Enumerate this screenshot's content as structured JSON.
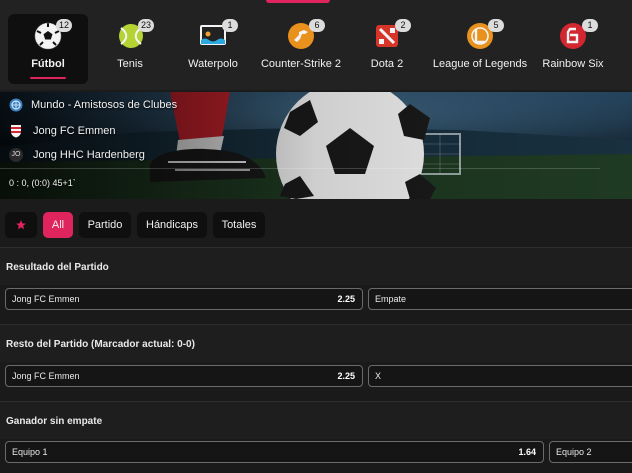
{
  "sports": [
    {
      "label": "Fútbol",
      "count": "12",
      "icon": "soccer-ball-icon",
      "active": true
    },
    {
      "label": "Tenis",
      "count": "23",
      "icon": "tennis-ball-icon",
      "active": false
    },
    {
      "label": "Waterpolo",
      "count": "1",
      "icon": "waterpolo-icon",
      "active": false
    },
    {
      "label": "Counter-Strike 2",
      "count": "6",
      "icon": "counter-strike-icon",
      "active": false
    },
    {
      "label": "Dota 2",
      "count": "2",
      "icon": "dota-icon",
      "active": false
    },
    {
      "label": "League of Legends",
      "count": "5",
      "icon": "league-of-legends-icon",
      "active": false
    },
    {
      "label": "Rainbow Six",
      "count": "1",
      "icon": "rainbow-six-icon",
      "active": false
    }
  ],
  "match": {
    "league": "Mundo - Amistosos de Clubes",
    "home": "Jong FC Emmen",
    "away": "Jong HHC Hardenberg",
    "away_badge": "JO",
    "score": "0 : 0, (0:0) 45+1`"
  },
  "filters": {
    "all": "All",
    "partido": "Partido",
    "handicaps": "Hándicaps",
    "totales": "Totales"
  },
  "markets": [
    {
      "title": "Resultado del Partido",
      "outcomes": [
        {
          "name": "Jong FC Emmen",
          "price": "2.25"
        },
        {
          "name": "Empate",
          "price": ""
        }
      ]
    },
    {
      "title": "Resto del Partido (Marcador actual: 0-0)",
      "outcomes": [
        {
          "name": "Jong FC Emmen",
          "price": "2.25"
        },
        {
          "name": "X",
          "price": ""
        }
      ]
    },
    {
      "title": "Ganador sin empate",
      "outcomes": [
        {
          "name": "Equipo 1",
          "price": "1.64"
        },
        {
          "name": "Equipo 2",
          "price": ""
        }
      ]
    }
  ],
  "colors": {
    "accent": "#e0245e",
    "background": "#1b1b1b",
    "panel": "#0f0f0f"
  }
}
